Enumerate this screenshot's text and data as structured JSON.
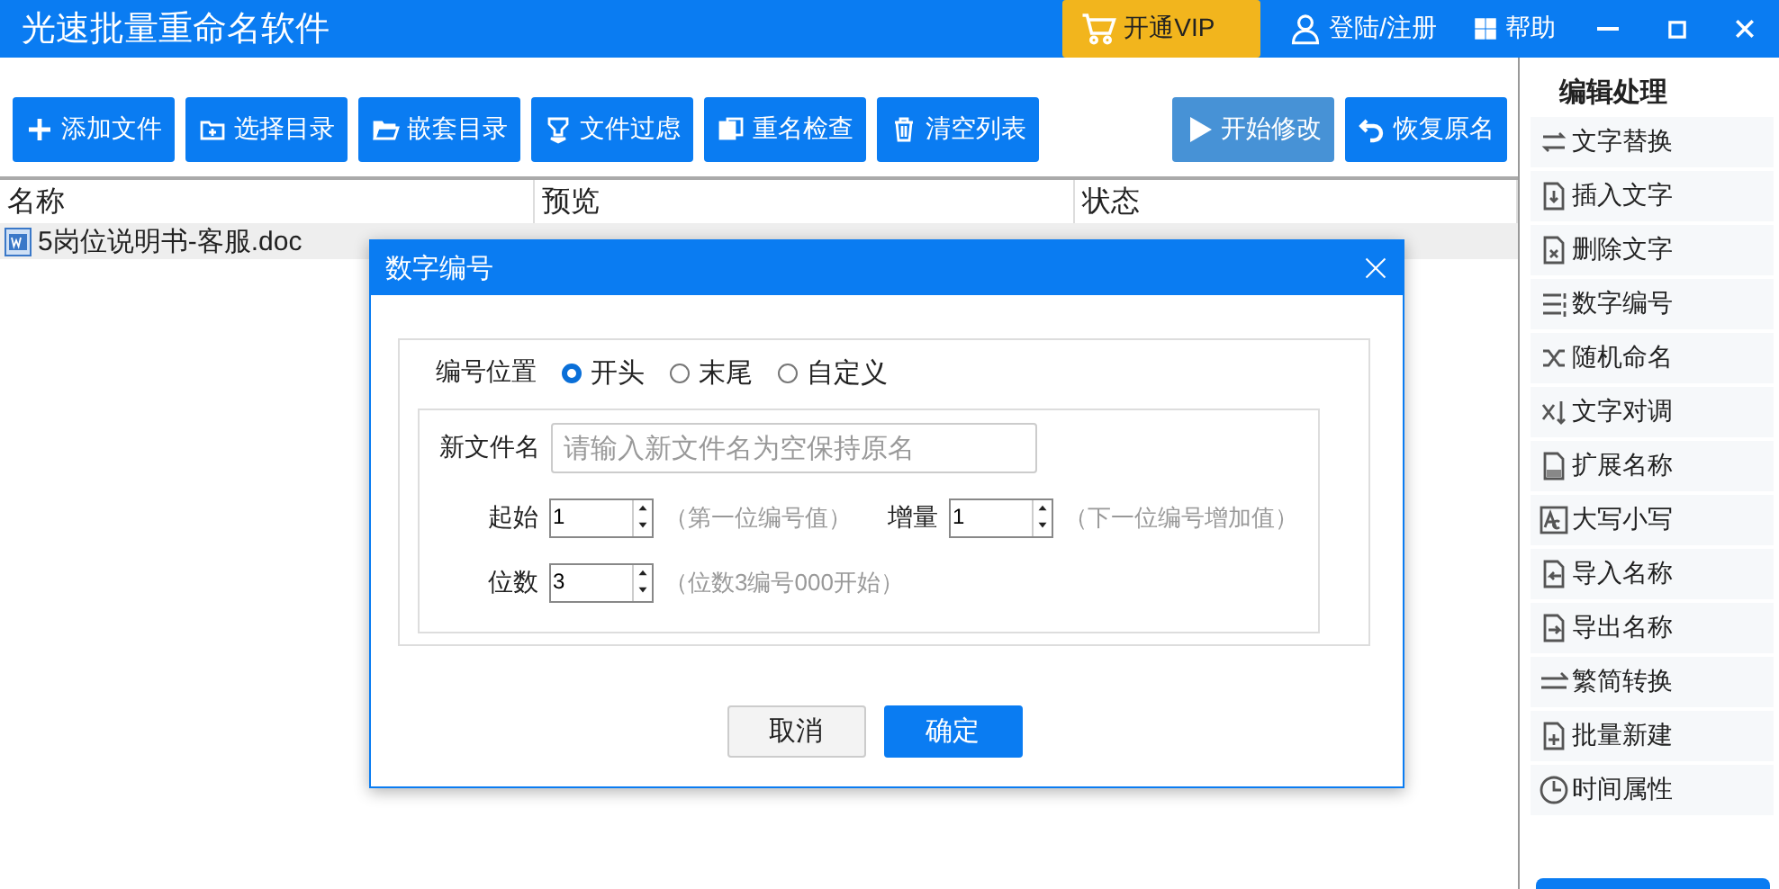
{
  "window": {
    "title": "光速批量重命名软件"
  },
  "header_actions": [
    {
      "kind": "vip",
      "label": "开通VIP"
    },
    {
      "kind": "user",
      "label": "登陆/注册"
    },
    {
      "kind": "help",
      "label": "帮助"
    }
  ],
  "toolbar": [
    {
      "label": "添加文件",
      "disabled": false
    },
    {
      "label": "选择目录",
      "disabled": false
    },
    {
      "label": "嵌套目录",
      "disabled": false
    },
    {
      "label": "文件过虑",
      "disabled": false
    },
    {
      "label": "重名检查",
      "disabled": false
    },
    {
      "label": "清空列表",
      "disabled": false
    }
  ],
  "toolbar_right": [
    {
      "label": "开始修改",
      "disabled": true
    },
    {
      "label": "恢复原名",
      "disabled": false
    }
  ],
  "table": {
    "columns": [
      "名称",
      "预览",
      "状态"
    ],
    "rows": [
      {
        "name": "5岗位说明书-客服.doc",
        "selected": true
      }
    ]
  },
  "sidebar": {
    "title": "编辑处理",
    "items": [
      {
        "label": "文字替换"
      },
      {
        "label": "插入文字"
      },
      {
        "label": "删除文字"
      },
      {
        "label": "数字编号"
      },
      {
        "label": "随机命名"
      },
      {
        "label": "文字对调"
      },
      {
        "label": "扩展名称"
      },
      {
        "label": "大写小写"
      },
      {
        "label": "导入名称"
      },
      {
        "label": "导出名称"
      },
      {
        "label": "繁简转换"
      },
      {
        "label": "批量新建"
      },
      {
        "label": "时间属性"
      }
    ]
  },
  "dialog": {
    "title": "数字编号",
    "position_label": "编号位置",
    "positions": [
      {
        "label": "开头",
        "selected": true
      },
      {
        "label": "末尾",
        "selected": false
      },
      {
        "label": "自定义",
        "selected": false
      }
    ],
    "new_name": {
      "label": "新文件名",
      "placeholder": "请输入新文件名为空保持原名"
    },
    "start": {
      "label": "起始",
      "value": "1",
      "hint": "（第一位编号值）"
    },
    "step": {
      "label": "增量",
      "value": "1",
      "hint": "（下一位编号增加值）"
    },
    "digits": {
      "label": "位数",
      "value": "3",
      "hint": "（位数3编号000开始）"
    },
    "buttons": [
      {
        "kind": "secondary",
        "label": "取消"
      },
      {
        "kind": "primary",
        "label": "确定"
      }
    ]
  }
}
